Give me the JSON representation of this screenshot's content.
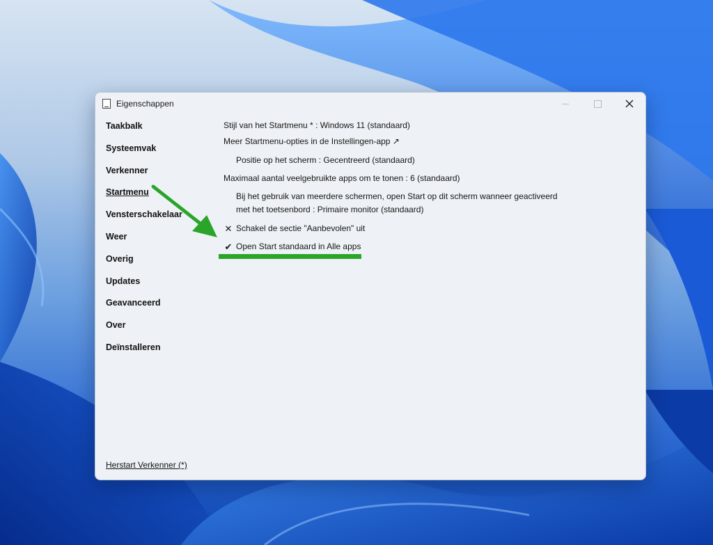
{
  "window": {
    "title": "Eigenschappen"
  },
  "sidebar": {
    "items": [
      {
        "label": "Taakbalk"
      },
      {
        "label": "Systeemvak"
      },
      {
        "label": "Verkenner"
      },
      {
        "label": "Startmenu",
        "selected": true
      },
      {
        "label": "Vensterschakelaar"
      },
      {
        "label": "Weer"
      },
      {
        "label": "Overig"
      },
      {
        "label": "Updates"
      },
      {
        "label": "Geavanceerd"
      },
      {
        "label": "Over"
      },
      {
        "label": "Deïnstalleren"
      }
    ],
    "restart_link": "Herstart Verkenner (*)"
  },
  "options": {
    "style": "Stijl van het Startmenu * : Windows 11 (standaard)",
    "more_options": "Meer Startmenu-opties in de Instellingen-app ↗",
    "position": "Positie op het scherm : Gecentreerd (standaard)",
    "max_apps": "Maximaal aantal veelgebruikte apps om te tonen : 6 (standaard)",
    "multi_monitor_line1": "Bij het gebruik van meerdere schermen, open Start op dit scherm wanneer geactiveerd",
    "multi_monitor_line2": "met het toetsenbord : Primaire monitor (standaard)",
    "recommended": {
      "mark": "✕",
      "label": "Schakel de sectie \"Aanbevolen\" uit",
      "checked": false
    },
    "all_apps": {
      "mark": "✔",
      "label": "Open Start standaard in Alle apps",
      "checked": true
    }
  },
  "annotation": {
    "color": "#2aa52a"
  }
}
